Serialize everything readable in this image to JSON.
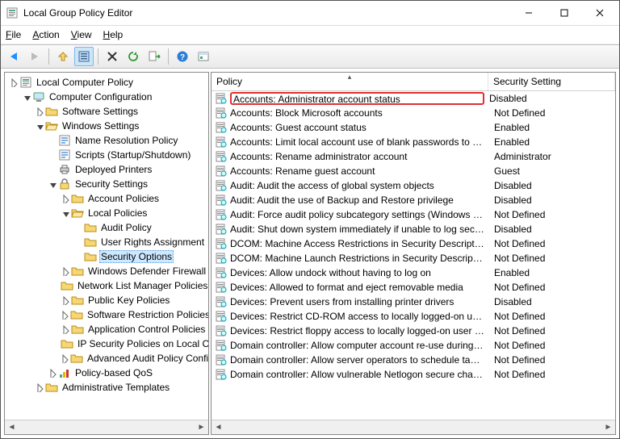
{
  "window": {
    "title": "Local Group Policy Editor"
  },
  "menu": {
    "file": "File",
    "action": "Action",
    "view": "View",
    "help": "Help"
  },
  "tree": {
    "root": "Local Computer Policy",
    "cc": "Computer Configuration",
    "ss": "Software Settings",
    "ws": "Windows Settings",
    "nrp": "Name Resolution Policy",
    "scr": "Scripts (Startup/Shutdown)",
    "dp": "Deployed Printers",
    "sec": "Security Settings",
    "ap": "Account Policies",
    "lp": "Local Policies",
    "aud": "Audit Policy",
    "ura": "User Rights Assignment",
    "so": "Security Options",
    "wdf": "Windows Defender Firewall",
    "nlmp": "Network List Manager Policies",
    "pkp": "Public Key Policies",
    "srp": "Software Restriction Policies",
    "acp": "Application Control Policies",
    "ips": "IP Security Policies on Local Computer",
    "aapc": "Advanced Audit Policy Configuration",
    "pqos": "Policy-based QoS",
    "atmp": "Administrative Templates"
  },
  "columns": {
    "policy": "Policy",
    "setting": "Security Setting"
  },
  "policies": [
    {
      "name": "Accounts: Administrator account status",
      "setting": "Disabled",
      "hl": true
    },
    {
      "name": "Accounts: Block Microsoft accounts",
      "setting": "Not Defined"
    },
    {
      "name": "Accounts: Guest account status",
      "setting": "Enabled"
    },
    {
      "name": "Accounts: Limit local account use of blank passwords to co...",
      "setting": "Enabled"
    },
    {
      "name": "Accounts: Rename administrator account",
      "setting": "Administrator"
    },
    {
      "name": "Accounts: Rename guest account",
      "setting": "Guest"
    },
    {
      "name": "Audit: Audit the access of global system objects",
      "setting": "Disabled"
    },
    {
      "name": "Audit: Audit the use of Backup and Restore privilege",
      "setting": "Disabled"
    },
    {
      "name": "Audit: Force audit policy subcategory settings (Windows Vis...",
      "setting": "Not Defined"
    },
    {
      "name": "Audit: Shut down system immediately if unable to log secur...",
      "setting": "Disabled"
    },
    {
      "name": "DCOM: Machine Access Restrictions in Security Descriptor D...",
      "setting": "Not Defined"
    },
    {
      "name": "DCOM: Machine Launch Restrictions in Security Descriptor D...",
      "setting": "Not Defined"
    },
    {
      "name": "Devices: Allow undock without having to log on",
      "setting": "Enabled"
    },
    {
      "name": "Devices: Allowed to format and eject removable media",
      "setting": "Not Defined"
    },
    {
      "name": "Devices: Prevent users from installing printer drivers",
      "setting": "Disabled"
    },
    {
      "name": "Devices: Restrict CD-ROM access to locally logged-on user ...",
      "setting": "Not Defined"
    },
    {
      "name": "Devices: Restrict floppy access to locally logged-on user only",
      "setting": "Not Defined"
    },
    {
      "name": "Domain controller: Allow computer account re-use during d...",
      "setting": "Not Defined"
    },
    {
      "name": "Domain controller: Allow server operators to schedule tasks",
      "setting": "Not Defined"
    },
    {
      "name": "Domain controller: Allow vulnerable Netlogon secure chann...",
      "setting": "Not Defined"
    }
  ]
}
